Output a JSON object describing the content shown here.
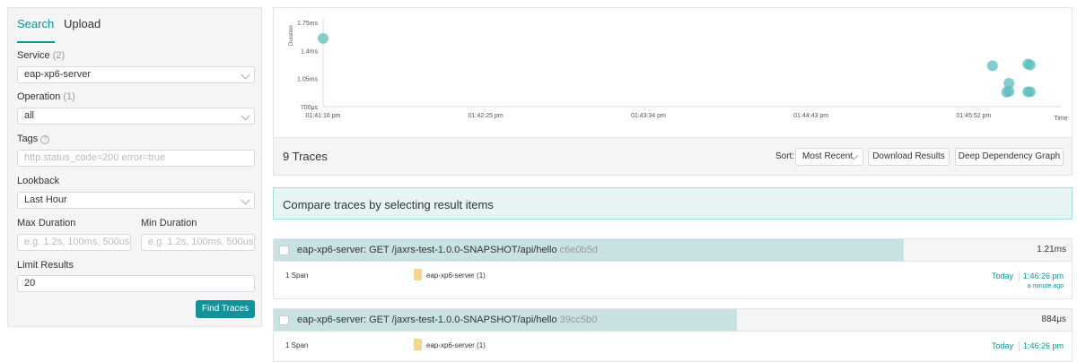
{
  "search_panel": {
    "tabs": [
      {
        "label": "Search"
      },
      {
        "label": "Upload"
      }
    ],
    "service": {
      "label": "Service",
      "count": "(2)",
      "value": "eap-xp6-server"
    },
    "operation": {
      "label": "Operation",
      "count": "(1)",
      "value": "all"
    },
    "tags": {
      "label": "Tags",
      "placeholder": "http.status_code=200 error=true"
    },
    "lookback": {
      "label": "Lookback",
      "value": "Last Hour"
    },
    "max_duration": {
      "label": "Max Duration",
      "placeholder": "e.g. 1.2s, 100ms, 500us"
    },
    "min_duration": {
      "label": "Min Duration",
      "placeholder": "e.g. 1.2s, 100ms, 500us"
    },
    "limit": {
      "label": "Limit Results",
      "value": "20"
    },
    "find_button": "Find Traces"
  },
  "chart_data": {
    "type": "scatter",
    "ylabel": "Duration",
    "xlabel": "Time",
    "y_ticks": [
      "1.75ms",
      "1.4ms",
      "1.05ms",
      "700μs"
    ],
    "y_tick_values": [
      1.75,
      1.4,
      1.05,
      0.7
    ],
    "ylim": [
      0.7,
      1.75
    ],
    "x_ticks": [
      "01:41:16 pm",
      "01:42:25 pm",
      "01:43:34 pm",
      "01:44:43 pm",
      "01:45:52 pm"
    ],
    "x_tick_values": [
      "13:41:16",
      "13:42:25",
      "13:43:34",
      "13:44:43",
      "13:45:52"
    ],
    "xlim": [
      "13:41:16",
      "13:46:29"
    ],
    "points": [
      {
        "x": "13:41:16",
        "y": 1.55
      },
      {
        "x": "13:46:00",
        "y": 1.21
      },
      {
        "x": "13:46:06",
        "y": 0.88
      },
      {
        "x": "13:46:07",
        "y": 0.99
      },
      {
        "x": "13:46:07",
        "y": 0.89
      },
      {
        "x": "13:46:15",
        "y": 1.23
      },
      {
        "x": "13:46:16",
        "y": 1.22
      },
      {
        "x": "13:46:16",
        "y": 0.884
      },
      {
        "x": "13:46:15",
        "y": 0.885
      }
    ],
    "color": "#5bbcbc"
  },
  "results_bar": {
    "count_label": "9 Traces",
    "sort_label": "Sort:",
    "sort_value": "Most Recent",
    "download_button": "Download Results",
    "ddg_button": "Deep Dependency Graph"
  },
  "compare_banner": "Compare traces by selecting result items",
  "traces": [
    {
      "title": "eap-xp6-server: GET /jaxrs-test-1.0.0-SNAPSHOT/api/hello",
      "trace_id": "c6e0b5d",
      "duration": "1.21ms",
      "duration_fraction": 0.79,
      "span_count": "1 Span",
      "service": "eap-xp6-server (1)",
      "day": "Today",
      "time": "1:46:26 pm",
      "ago": "a minute ago"
    },
    {
      "title": "eap-xp6-server: GET /jaxrs-test-1.0.0-SNAPSHOT/api/hello",
      "trace_id": "39cc5b0",
      "duration": "884μs",
      "duration_fraction": 0.58,
      "span_count": "1 Span",
      "service": "eap-xp6-server (1)",
      "day": "Today",
      "time": "1:46:26 pm"
    }
  ]
}
